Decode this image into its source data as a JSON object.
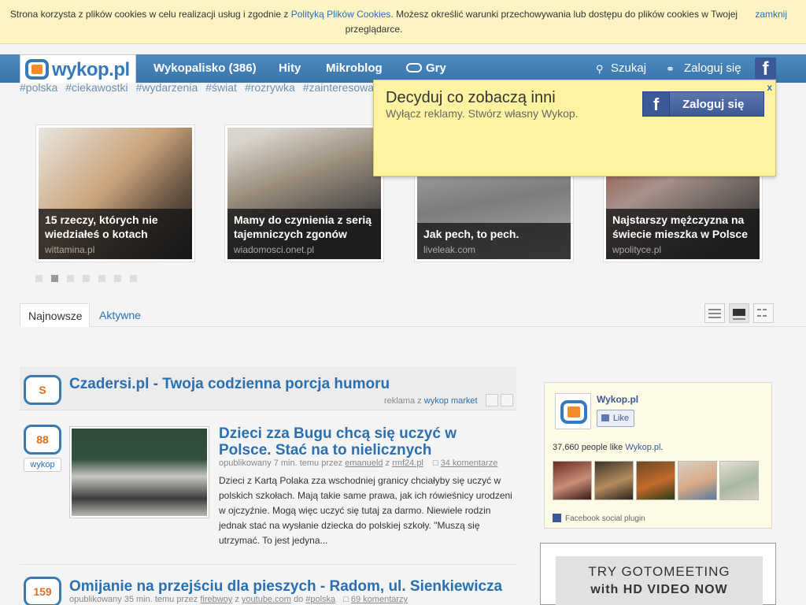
{
  "cookie": {
    "text_before": "Strona korzysta z plików cookies w celu realizacji usług i zgodnie z ",
    "link": "Polityką Plików Cookies",
    "text_after": ". Możesz określić warunki przechowywania lub dostępu do plików cookies w Twojej przeglądarce.",
    "close": "zamknij"
  },
  "header": {
    "logo": "wykop.pl",
    "nav": [
      "Wykopalisko (386)",
      "Hity",
      "Mikroblog",
      "Gry"
    ],
    "search": "Szukaj",
    "login": "Zaloguj się",
    "fb": "f"
  },
  "tags": [
    "#polska",
    "#ciekawostki",
    "#wydarzenia",
    "#świat",
    "#rozrywka",
    "#zainteresowania"
  ],
  "promo": {
    "title": "Decyduj co zobaczą inni",
    "subtitle": "Wyłącz reklamy. Stwórz własny Wykop.",
    "close": "x",
    "fb_login": "Zaloguj się",
    "fb_letter": "f"
  },
  "featured": [
    {
      "title": "15 rzeczy, których nie wiedziałeś o kotach",
      "source": "wittamina.pl"
    },
    {
      "title": "Mamy do czynienia z serią tajemniczych zgonów",
      "source": "wiadomosci.onet.pl"
    },
    {
      "title": "Jak pech, to pech.",
      "source": "liveleak.com"
    },
    {
      "title": "Najstarszy mężczyzna na świecie mieszka w Polsce",
      "source": "wpolityce.pl"
    }
  ],
  "tabs": {
    "newest": "Najnowsze",
    "active": "Aktywne"
  },
  "ad": {
    "badge": "S",
    "title": "Czadersi.pl - Twoja codzienna porcja humoru",
    "label": "reklama z ",
    "link": "wykop market"
  },
  "entries": [
    {
      "votes": "88",
      "vote_btn": "wykop",
      "title": "Dzieci zza Bugu chcą się uczyć w Polsce. Stać na to nielicznych",
      "meta_pre": "opublikowany 7 min. temu przez ",
      "user": "emanueld",
      "meta_mid": " z ",
      "domain": "rmf24.pl",
      "comments": "34 komentarze",
      "description": "Dzieci z Kartą Polaka zza wschodniej granicy chciałyby się uczyć w polskich szkołach. Mają takie same prawa, jak ich rówieśnicy urodzeni w ojczyźnie. Mogą więc uczyć się tutaj za darmo. Niewiele rodzin jednak stać na wysłanie dziecka do polskiej szkoły. \"Muszą się utrzymać. To jest jedyna..."
    },
    {
      "votes": "159",
      "title": "Omijanie na przejściu dla pieszych - Radom, ul. Sienkiewicza",
      "meta_pre": "opublikowany 35 min. temu przez ",
      "user": "firebwoy",
      "meta_mid": " z ",
      "domain": "youtube.com",
      "meta_tag_pre": " do ",
      "tag": "#polska",
      "comments": "69 komentarzy"
    }
  ],
  "fb_widget": {
    "name": "Wykop.pl",
    "like": "Like",
    "count_pre": "37,660 people like ",
    "count_link": "Wykop.pl",
    "count_post": ".",
    "plugin": "Facebook social plugin"
  },
  "sidebar_ad": {
    "line1": "TRY GOTOMEETING",
    "line2": "with HD VIDEO NOW"
  }
}
